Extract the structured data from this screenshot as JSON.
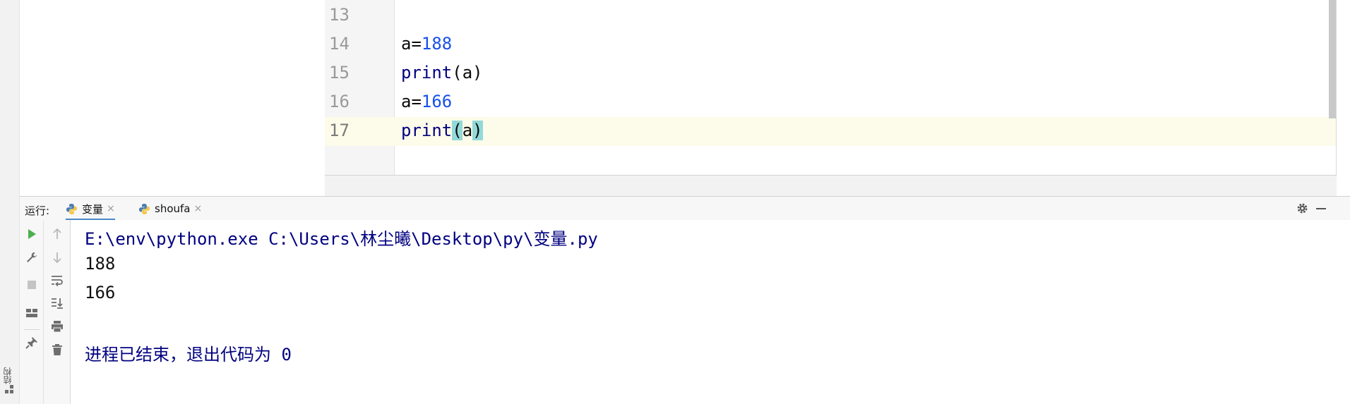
{
  "editor": {
    "lines": [
      {
        "num": "13",
        "code": ""
      },
      {
        "num": "14",
        "code_prefix": "a=",
        "code_number": "188"
      },
      {
        "num": "15",
        "code_fn": "print",
        "code_rest": "(a)"
      },
      {
        "num": "16",
        "code_prefix": "a=",
        "code_number": "166"
      },
      {
        "num": "17",
        "code_fn": "print",
        "open_paren": "(",
        "arg": "a",
        "close_paren": ")"
      }
    ]
  },
  "run_panel": {
    "title": "运行:",
    "tabs": [
      {
        "label": "变量",
        "close": "×"
      },
      {
        "label": "shoufa",
        "close": "×"
      }
    ]
  },
  "console": {
    "command": "E:\\env\\python.exe C:\\Users\\林尘曦\\Desktop\\py\\变量.py",
    "outputs": [
      "188",
      "166"
    ],
    "exit_message": "进程已结束，退出代码为 0"
  },
  "side_strip": {
    "structure_label": "结构"
  },
  "colors": {
    "number": "#1750eb",
    "keyword_fn": "#000080",
    "paren_highlight": "#93d9d9",
    "current_line": "#fdfbe9",
    "run_green": "#4caf50",
    "tab_underline": "#4a88c7"
  },
  "icons": {
    "toolbar_left": [
      "run-icon",
      "wrench-icon",
      "stop-icon",
      "layout-icon",
      "pin-icon"
    ],
    "toolbar_right": [
      "arrow-up-icon",
      "arrow-down-icon",
      "soft-wrap-icon",
      "scroll-to-end-icon",
      "print-icon",
      "trash-icon"
    ]
  }
}
